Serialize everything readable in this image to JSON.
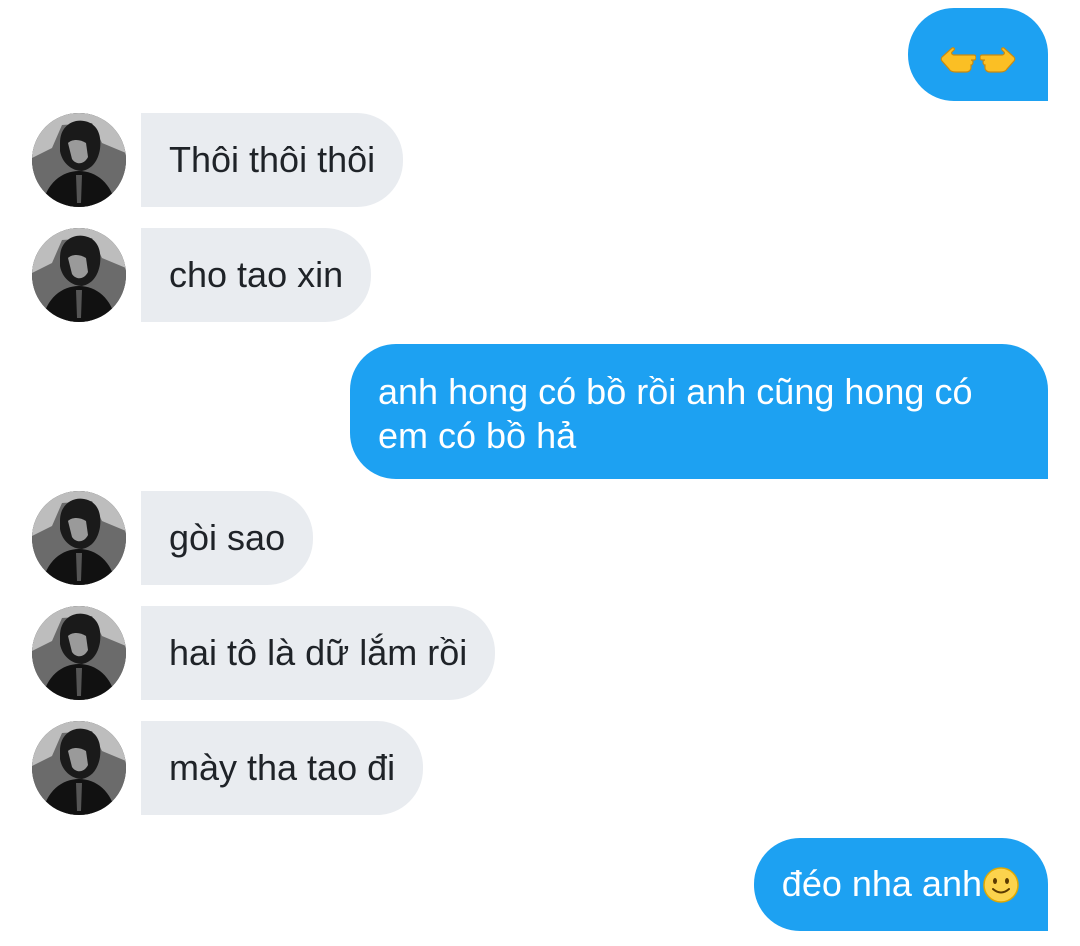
{
  "conversation": {
    "messages": [
      {
        "id": "m1",
        "direction": "out",
        "emoji": [
          "backhand-index-pointing-left",
          "backhand-index-pointing-right"
        ]
      },
      {
        "id": "m2",
        "direction": "in",
        "text": "Thôi thôi thôi"
      },
      {
        "id": "m3",
        "direction": "in",
        "text": "cho tao xin"
      },
      {
        "id": "m4",
        "direction": "out",
        "lines": [
          "anh hong có bồ rồi anh cũng hong có",
          "em có bồ hả"
        ]
      },
      {
        "id": "m5",
        "direction": "in",
        "text": "gòi sao"
      },
      {
        "id": "m6",
        "direction": "in",
        "text": "hai tô là dữ lắm rồi"
      },
      {
        "id": "m7",
        "direction": "in",
        "text": "mày tha tao đi"
      },
      {
        "id": "m8",
        "direction": "out",
        "text": "đéo nha anh",
        "emoji": [
          "slightly-smiling-face"
        ]
      }
    ]
  },
  "colors": {
    "outgoing_bubble": "#1da1f2",
    "incoming_bubble": "#e9ecf0",
    "incoming_text": "#1f2328",
    "outgoing_text": "#ffffff",
    "background": "#ffffff"
  }
}
